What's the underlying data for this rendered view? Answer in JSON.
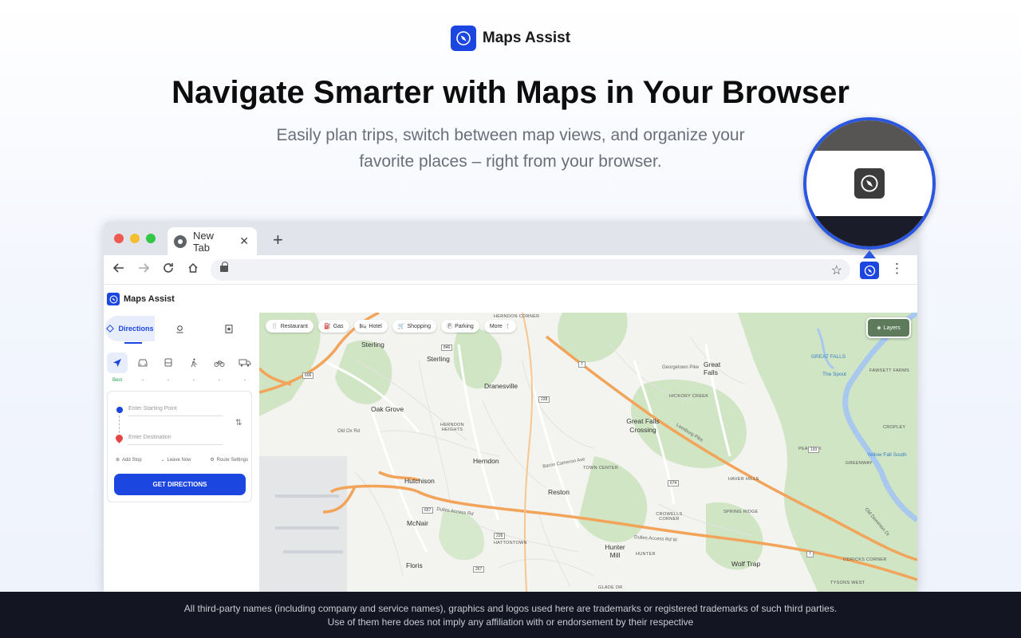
{
  "brand": {
    "name": "Maps Assist"
  },
  "hero": {
    "headline": "Navigate Smarter with Maps in Your Browser",
    "subline": "Easily plan trips, switch between map views, and organize your favorite places – right from your browser."
  },
  "browser": {
    "tab_title": "New Tab",
    "tab_close": "✕",
    "new_tab": "+"
  },
  "app": {
    "name": "Maps Assist",
    "tabs": [
      {
        "label": "Directions",
        "icon": "directions-icon"
      },
      {
        "label": "",
        "icon": "saved-place-icon"
      },
      {
        "label": "",
        "icon": "bookmark-icon"
      }
    ],
    "modes": [
      {
        "icon": "navigate-icon",
        "label": "Best"
      },
      {
        "icon": "car-icon",
        "label": "-"
      },
      {
        "icon": "bus-icon",
        "label": "-"
      },
      {
        "icon": "walk-icon",
        "label": "-"
      },
      {
        "icon": "bike-icon",
        "label": "-"
      },
      {
        "icon": "truck-icon",
        "label": "-"
      }
    ],
    "start_placeholder": "Enter Starting Point",
    "dest_placeholder": "Enter Destination",
    "options": {
      "add_stop": "Add Stop",
      "leave_now": "Leave Now",
      "route_settings": "Route Settings"
    },
    "get_directions": "GET DIRECTIONS"
  },
  "map": {
    "chips": [
      {
        "label": "Restaurant",
        "icon": "restaurant-icon"
      },
      {
        "label": "Gas",
        "icon": "gas-icon"
      },
      {
        "label": "Hotel",
        "icon": "hotel-icon"
      },
      {
        "label": "Shopping",
        "icon": "shopping-icon"
      },
      {
        "label": "Parking",
        "icon": "parking-icon"
      },
      {
        "label": "More",
        "icon": "more-icon"
      }
    ],
    "layers": "Layers",
    "places": [
      "Sterling",
      "Dranesville",
      "Oak Grove",
      "Herndon",
      "Hutchison",
      "Reston",
      "McNair",
      "Floris",
      "Great Falls",
      "Great Falls Crossing",
      "Hunter Mill",
      "Wolf Trap",
      "Sterling"
    ],
    "caps": [
      "HERNDON HEIGHTS",
      "TOWN CENTER",
      "HICKORY CREEK",
      "HAVER HILLS",
      "CROWELLS CORNER",
      "SPRING RIDGE",
      "PEACOCK",
      "GREENWAY",
      "HATTONTOWN",
      "HUNTER",
      "FAWSETT FARMS",
      "CROPLEY",
      "ODRICKS CORNER",
      "TYSONS WEST",
      "GLADE DR",
      "HERNDON CORNER"
    ],
    "roads": [
      "Dulles Access Rd",
      "Leesburg Pike",
      "Georgetown Pike",
      "Baron Cameron Ave",
      "Dulles Access Rd W",
      "Old Ox Rd",
      "Old Dominion Dr"
    ],
    "water": [
      "GREAT FALLS",
      "The Spout",
      "Yellow Fall South"
    ],
    "shields": [
      "606",
      "846",
      "7",
      "228",
      "674",
      "193",
      "657",
      "228",
      "267",
      "7",
      "7"
    ]
  },
  "footer": {
    "line1": "All third-party names (including company and service names), graphics and logos used here are trademarks or registered trademarks of such third parties.",
    "line2": "Use of them here does not imply any affiliation with or endorsement by their respective"
  },
  "colors": {
    "accent": "#1c46e0",
    "footer_bg": "#131522",
    "map_green": "#cfe5c4",
    "road_orange": "#f2a45a"
  }
}
